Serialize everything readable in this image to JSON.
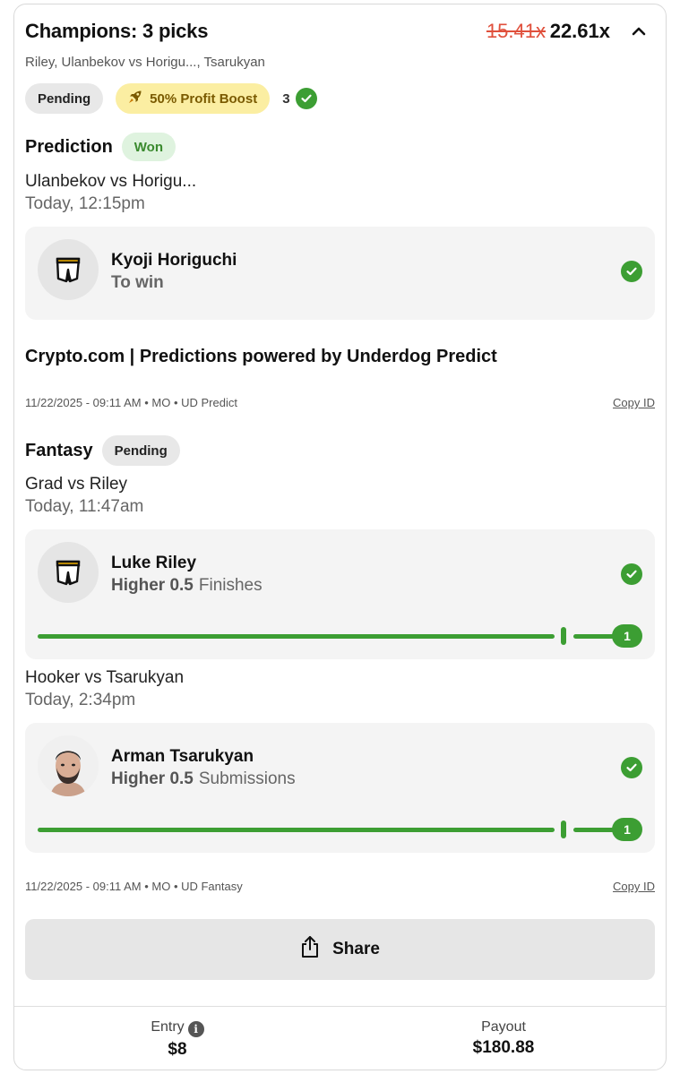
{
  "header": {
    "title": "Champions: 3 picks",
    "old_multiplier": "15.41x",
    "new_multiplier": "22.61x",
    "subtitle": "Riley, Ulanbekov vs Horigu..., Tsarukyan",
    "status": "Pending",
    "boost_label": "50% Profit Boost",
    "checked_count": "3"
  },
  "prediction": {
    "heading": "Prediction",
    "status": "Won",
    "match": "Ulanbekov vs Horigu...",
    "time": "Today, 12:15pm",
    "pick": {
      "player": "Kyoji Horiguchi",
      "line": "To win"
    },
    "disclaimer": "Crypto.com | Predictions powered by Underdog Predict",
    "meta": "11/22/2025 - 09:11 AM • MO • UD Predict",
    "copy_label": "Copy ID"
  },
  "fantasy": {
    "heading": "Fantasy",
    "status": "Pending",
    "picks": [
      {
        "match": "Grad vs Riley",
        "time": "Today, 11:47am",
        "player": "Luke Riley",
        "line": "Higher 0.5",
        "stat": "Finishes",
        "progress_value": "1",
        "progress_fraction": 1.0
      },
      {
        "match": "Hooker vs Tsarukyan",
        "time": "Today, 2:34pm",
        "player": "Arman Tsarukyan",
        "line": "Higher 0.5",
        "stat": "Submissions",
        "progress_value": "1",
        "progress_fraction": 1.0
      }
    ],
    "meta": "11/22/2025 - 09:11 AM • MO • UD Fantasy",
    "copy_label": "Copy ID"
  },
  "share_label": "Share",
  "footer": {
    "entry_label": "Entry",
    "entry_value": "$8",
    "payout_label": "Payout",
    "payout_value": "$180.88"
  },
  "colors": {
    "accent_green": "#3c9e33",
    "strike_red": "#e0503c",
    "boost_bg": "#fbeea2"
  },
  "icons": [
    "chevron-up-icon",
    "rocket-icon",
    "check-circle-icon",
    "shorts-icon",
    "share-icon",
    "info-icon"
  ]
}
